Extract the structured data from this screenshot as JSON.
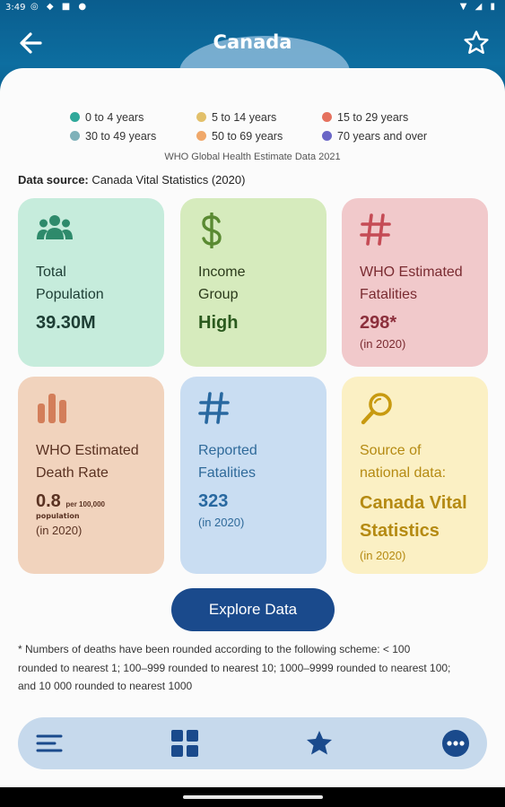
{
  "status_bar": {
    "time": "3:49"
  },
  "header": {
    "title": "Canada"
  },
  "legend": {
    "items": [
      {
        "label": "0 to 4 years",
        "color": "#2fa89a"
      },
      {
        "label": "5 to 14 years",
        "color": "#e2c06a"
      },
      {
        "label": "15 to 29 years",
        "color": "#e5715e"
      },
      {
        "label": "30 to 49 years",
        "color": "#7fb1b9"
      },
      {
        "label": "50 to 69 years",
        "color": "#f0a86a"
      },
      {
        "label": "70 years and over",
        "color": "#6a66c6"
      }
    ],
    "caption": "WHO Global Health Estimate Data 2021"
  },
  "data_source": {
    "label": "Data source:",
    "value": "Canada Vital Statistics (2020)"
  },
  "cards": {
    "population": {
      "label_line1": "Total",
      "label_line2": "Population",
      "value": "39.30M",
      "icon": "people-icon"
    },
    "income": {
      "label_line1": "Income",
      "label_line2": "Group",
      "value": "High",
      "icon": "dollar-icon"
    },
    "who_fatalities": {
      "label_line1": "WHO Estimated",
      "label_line2": "Fatalities",
      "value": "298*",
      "sub": "(in 2020)",
      "icon": "hash-icon"
    },
    "death_rate": {
      "label_line1": "WHO Estimated",
      "label_line2": "Death Rate",
      "value": "0.8",
      "unit_line1": "per 100,000",
      "unit_line2": "population",
      "sub": "(in 2020)",
      "icon": "bar-chart-icon"
    },
    "reported": {
      "label_line1": "Reported",
      "label_line2": "Fatalities",
      "value": "323",
      "sub": "(in 2020)",
      "icon": "hash-icon"
    },
    "national_source": {
      "label_line1": "Source of",
      "label_line2": "national data:",
      "value_line1": "Canada Vital",
      "value_line2": "Statistics",
      "sub": "(in 2020)",
      "icon": "magnifier-icon"
    }
  },
  "explore_button": {
    "label": "Explore Data"
  },
  "footnote": {
    "line1": "* Numbers of deaths have been rounded according to the following scheme: < 100",
    "line2": "rounded to nearest 1; 100–999 rounded to nearest 10; 1000–9999 rounded to nearest 100;",
    "line3": "and  10 000 rounded to nearest 1000"
  },
  "bottom_nav": {
    "items": [
      {
        "icon": "menu-icon"
      },
      {
        "icon": "grid-icon"
      },
      {
        "icon": "star-icon"
      },
      {
        "icon": "more-icon"
      }
    ]
  },
  "colors": {
    "header_blue": "#0b5a8a",
    "button_blue": "#1a4a8c",
    "nav_icon": "#1a4a8c"
  }
}
